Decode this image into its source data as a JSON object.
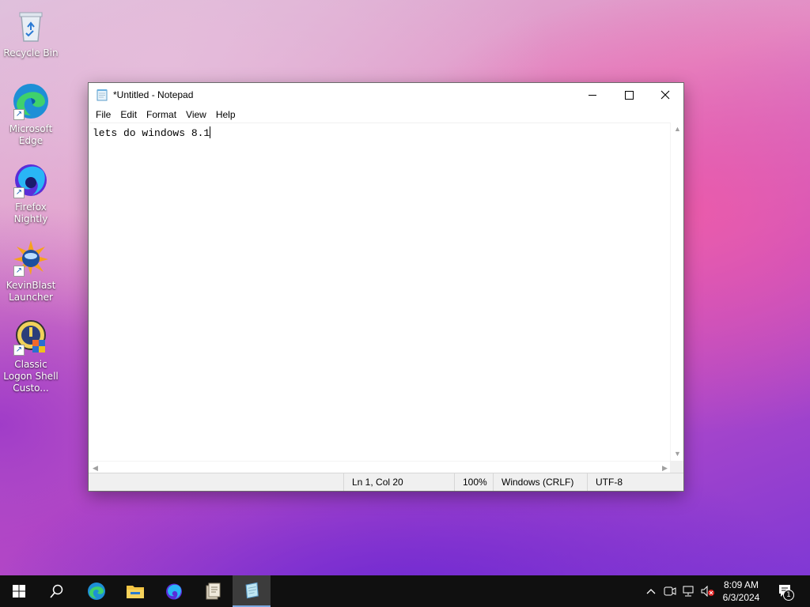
{
  "desktop": {
    "icons": [
      {
        "label": "Recycle Bin"
      },
      {
        "label": "Microsoft Edge"
      },
      {
        "label": "Firefox Nightly"
      },
      {
        "label": "KevinBlast Launcher"
      },
      {
        "label": "Classic Logon Shell Custo..."
      }
    ]
  },
  "notepad": {
    "title": "*Untitled - Notepad",
    "menu": [
      "File",
      "Edit",
      "Format",
      "View",
      "Help"
    ],
    "content": "lets do windows 8.1",
    "status": {
      "position": "Ln 1, Col 20",
      "zoom": "100%",
      "line_ending": "Windows (CRLF)",
      "encoding": "UTF-8"
    }
  },
  "taskbar": {
    "clock_time": "8:09 AM",
    "clock_date": "6/3/2024",
    "notification_count": "1"
  },
  "colors": {
    "taskbar_bg": "#101010",
    "active_task": "#3c3c3c",
    "accent": "#7aa7e0"
  }
}
